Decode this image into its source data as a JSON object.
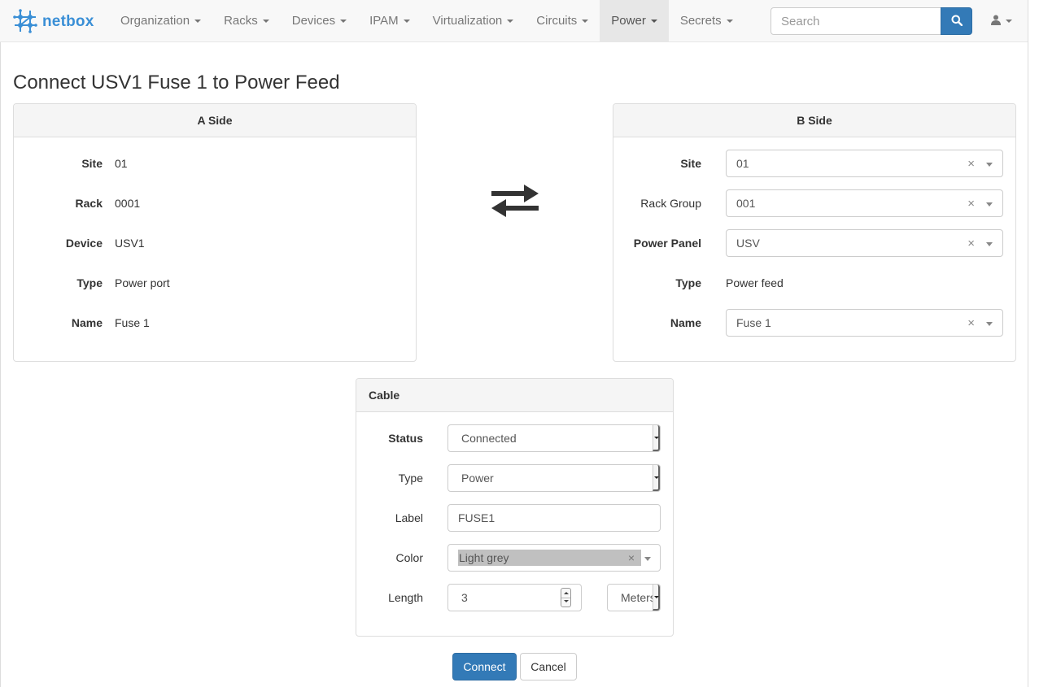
{
  "brand": {
    "name": "netbox",
    "logo_icon": "netbox-logo-icon"
  },
  "nav": {
    "items": [
      {
        "label": "Organization",
        "active": false
      },
      {
        "label": "Racks",
        "active": false
      },
      {
        "label": "Devices",
        "active": false
      },
      {
        "label": "IPAM",
        "active": false
      },
      {
        "label": "Virtualization",
        "active": false
      },
      {
        "label": "Circuits",
        "active": false
      },
      {
        "label": "Power",
        "active": true
      },
      {
        "label": "Secrets",
        "active": false
      }
    ],
    "search_placeholder": "Search",
    "search_value": "",
    "search_icon": "search-icon",
    "user_icon": "user-icon"
  },
  "page": {
    "title": "Connect USV1 Fuse 1 to Power Feed"
  },
  "a_side": {
    "heading": "A Side",
    "rows": [
      {
        "label": "Site",
        "value": "01"
      },
      {
        "label": "Rack",
        "value": "0001"
      },
      {
        "label": "Device",
        "value": "USV1"
      },
      {
        "label": "Type",
        "value": "Power port"
      },
      {
        "label": "Name",
        "value": "Fuse 1"
      }
    ]
  },
  "b_side": {
    "heading": "B Side",
    "site": {
      "label": "Site",
      "value": "01"
    },
    "rack_group": {
      "label": "Rack Group",
      "value": "001"
    },
    "power_panel": {
      "label": "Power Panel",
      "value": "USV"
    },
    "type": {
      "label": "Type",
      "value": "Power feed"
    },
    "name": {
      "label": "Name",
      "value": "Fuse 1"
    },
    "clear_glyph": "×"
  },
  "swap_icon": "exchange-arrows-icon",
  "cable": {
    "heading": "Cable",
    "status": {
      "label": "Status",
      "value": "Connected"
    },
    "type": {
      "label": "Type",
      "value": "Power"
    },
    "label": {
      "label": "Label",
      "value": "FUSE1"
    },
    "color": {
      "label": "Color",
      "value": "Light grey",
      "swatch": "#c0c0c0"
    },
    "length": {
      "label": "Length",
      "value": "3",
      "unit": "Meters"
    }
  },
  "actions": {
    "connect": "Connect",
    "cancel": "Cancel"
  },
  "colors": {
    "primary": "#337ab7",
    "brand": "#3a8fd6",
    "navbar_bg": "#f8f8f8"
  }
}
